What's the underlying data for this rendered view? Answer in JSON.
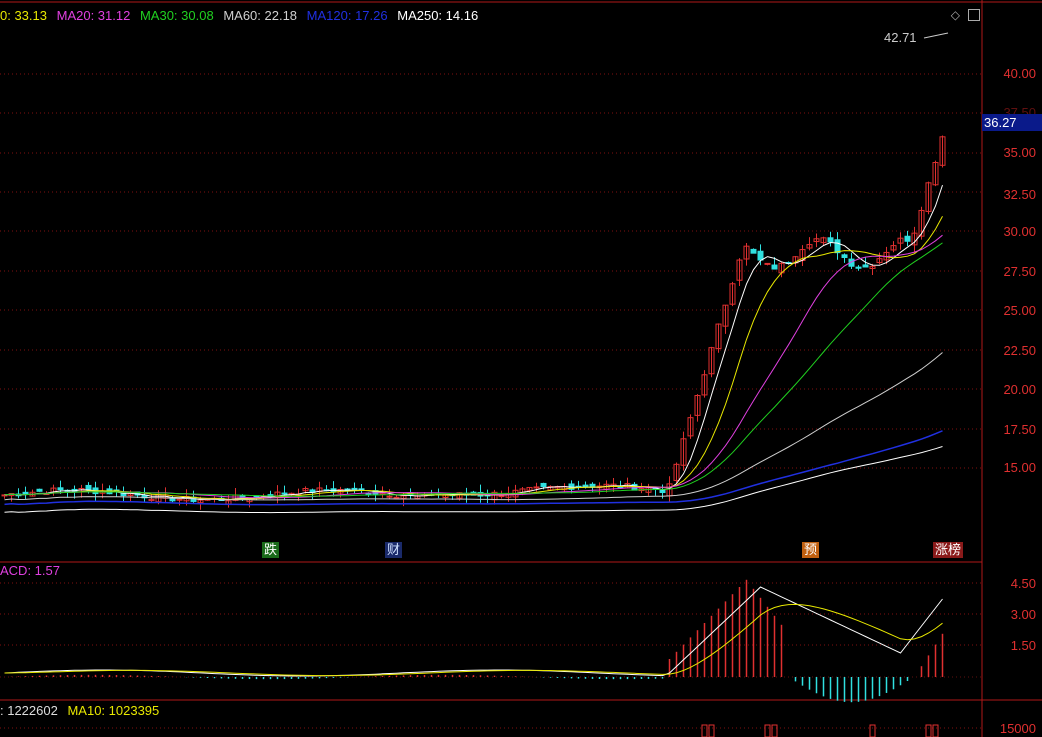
{
  "ma_legend": [
    {
      "label": "0: 33.13",
      "color": "#e8e800"
    },
    {
      "label": "MA20: 31.12",
      "color": "#e040e0"
    },
    {
      "label": "MA30: 30.08",
      "color": "#20d020"
    },
    {
      "label": "MA60: 22.18",
      "color": "#d0d0d0"
    },
    {
      "label": "MA120: 17.26",
      "color": "#2030e0"
    },
    {
      "label": "MA250: 14.16",
      "color": "#ffffff"
    }
  ],
  "price_axis": [
    "40.00",
    "37.50",
    "35.00",
    "32.50",
    "30.00",
    "27.50",
    "25.00",
    "22.50",
    "20.00",
    "17.50",
    "15.00"
  ],
  "current_price": "36.27",
  "high_price_label": "42.71",
  "event_markers": [
    {
      "text": "跌",
      "bg": "#1a6a1a",
      "color": "#ffffff"
    },
    {
      "text": "财",
      "bg": "#1a2a6a",
      "color": "#cfe0ff"
    },
    {
      "text": "预",
      "bg": "#c06010",
      "color": "#ffffff"
    },
    {
      "text": "涨榜",
      "bg": "#8a1a1a",
      "color": "#ffffff"
    }
  ],
  "macd_legend": "ACD: 1.57",
  "macd_axis": [
    "4.50",
    "3.00",
    "1.50"
  ],
  "volume_legend": [
    {
      "label": ": 1222602",
      "color": "#dddddd"
    },
    {
      "label": "MA10: 1023395",
      "color": "#e8e800"
    }
  ],
  "volume_axis": [
    "15000"
  ],
  "colors": {
    "up": "#e03030",
    "down": "#30e0e0",
    "grid": "#801010",
    "ma5": "#ffffff",
    "ma10": "#e8e800",
    "ma20": "#e040e0",
    "ma30": "#20d020",
    "ma60": "#d0d0d0",
    "ma120": "#2030e0",
    "ma250": "#ffffff"
  }
}
